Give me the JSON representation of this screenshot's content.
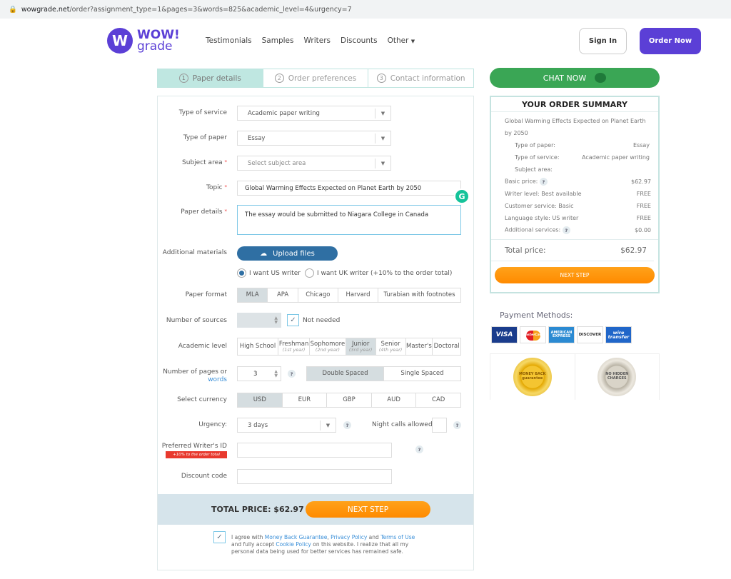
{
  "browser": {
    "url_domain": "wowgrade.net",
    "url_path": "/order?assignment_type=1&pages=3&words=825&academic_level=4&urgency=7"
  },
  "header": {
    "logo_line1": "WOW!",
    "logo_line2": "grade",
    "nav": [
      "Testimonials",
      "Samples",
      "Writers",
      "Discounts",
      "Other"
    ],
    "sign_in": "Sign In",
    "order_now": "Order Now",
    "accent": "#5b3fd6"
  },
  "steps": [
    {
      "num": "1",
      "label": "Paper details"
    },
    {
      "num": "2",
      "label": "Order preferences"
    },
    {
      "num": "3",
      "label": "Contact information"
    }
  ],
  "chat": {
    "label": "CHAT NOW"
  },
  "form": {
    "type_of_service": {
      "label": "Type of service",
      "value": "Academic paper writing"
    },
    "type_of_paper": {
      "label": "Type of paper",
      "value": "Essay"
    },
    "subject_area": {
      "label": "Subject area",
      "placeholder": "Select subject area"
    },
    "topic": {
      "label": "Topic",
      "value": "Global Warming Effects Expected on Planet Earth by 2050"
    },
    "paper_details": {
      "label": "Paper details",
      "value": "The essay would be submitted to Niagara College in Canada"
    },
    "additional_materials": {
      "label": "Additional materials",
      "button": "Upload files"
    },
    "writer": {
      "us": "I want US writer",
      "uk": "I want UK writer (+10% to the order total)",
      "selected": "us"
    },
    "paper_format": {
      "label": "Paper format",
      "options": [
        "MLA",
        "APA",
        "Chicago",
        "Harvard",
        "Turabian with footnotes"
      ],
      "selected": "MLA"
    },
    "sources": {
      "label": "Number of sources",
      "not_needed": "Not needed",
      "not_needed_checked": true
    },
    "academic_level": {
      "label": "Academic level",
      "options": [
        {
          "name": "High School",
          "sub": ""
        },
        {
          "name": "Freshman",
          "sub": "(1st year)"
        },
        {
          "name": "Sophomore",
          "sub": "(2nd year)"
        },
        {
          "name": "Junior",
          "sub": "(3rd year)"
        },
        {
          "name": "Senior",
          "sub": "(4th year)"
        },
        {
          "name": "Master's",
          "sub": ""
        },
        {
          "name": "Doctoral",
          "sub": ""
        }
      ],
      "selected": "Junior"
    },
    "pages": {
      "label": "Number of pages or",
      "label_link": "words",
      "value": "3",
      "spacing": [
        "Double Spaced",
        "Single Spaced"
      ],
      "selected": "Double Spaced"
    },
    "currency": {
      "label": "Select currency",
      "options": [
        "USD",
        "EUR",
        "GBP",
        "AUD",
        "CAD"
      ],
      "selected": "USD"
    },
    "urgency": {
      "label": "Urgency:",
      "value": "3 days",
      "night_calls": "Night calls allowed"
    },
    "preferred_writer": {
      "label": "Preferred Writer's ID",
      "ribbon": "+10% to the order total"
    },
    "discount": {
      "label": "Discount code"
    },
    "total": "TOTAL PRICE: $62.97",
    "next_step": "NEXT STEP",
    "agree": {
      "checked": true,
      "t1": "I agree with ",
      "l1": "Money Back Guarantee",
      "t2": ", ",
      "l2": "Privacy Policy",
      "t3": " and ",
      "l3": "Terms of Use",
      "t4": " and fully accept ",
      "l4": "Cookie Policy",
      "t5": " on this website. I realize that all my personal data being used for better services has remained safe."
    }
  },
  "summary": {
    "title": "YOUR ORDER SUMMARY",
    "topic": "Global Warming Effects Expected on Planet Earth by 2050",
    "details": [
      {
        "k": "Type of paper:",
        "v": "Essay"
      },
      {
        "k": "Type of service:",
        "v": "Academic paper writing"
      },
      {
        "k": "Subject area:",
        "v": ""
      }
    ],
    "prices": [
      {
        "k": "Basic price:",
        "v": "$62.97",
        "help": true
      },
      {
        "k": "Writer level: Best available",
        "v": "FREE"
      },
      {
        "k": "Customer service: Basic",
        "v": "FREE"
      },
      {
        "k": "Language style: US writer",
        "v": "FREE"
      },
      {
        "k": "Additional services:",
        "v": "$0.00",
        "help": true
      }
    ],
    "total_label": "Total price:",
    "total_value": "$62.97",
    "next_step": "NEXT STEP"
  },
  "payment": {
    "title": "Payment Methods:",
    "cards": [
      "VISA",
      "MasterCard",
      "AMERICAN EXPRESS",
      "DISCOVER",
      "wire transfer"
    ],
    "badges": [
      "MONEY BACK guarantee",
      "NO HIDDEN CHARGES"
    ]
  }
}
